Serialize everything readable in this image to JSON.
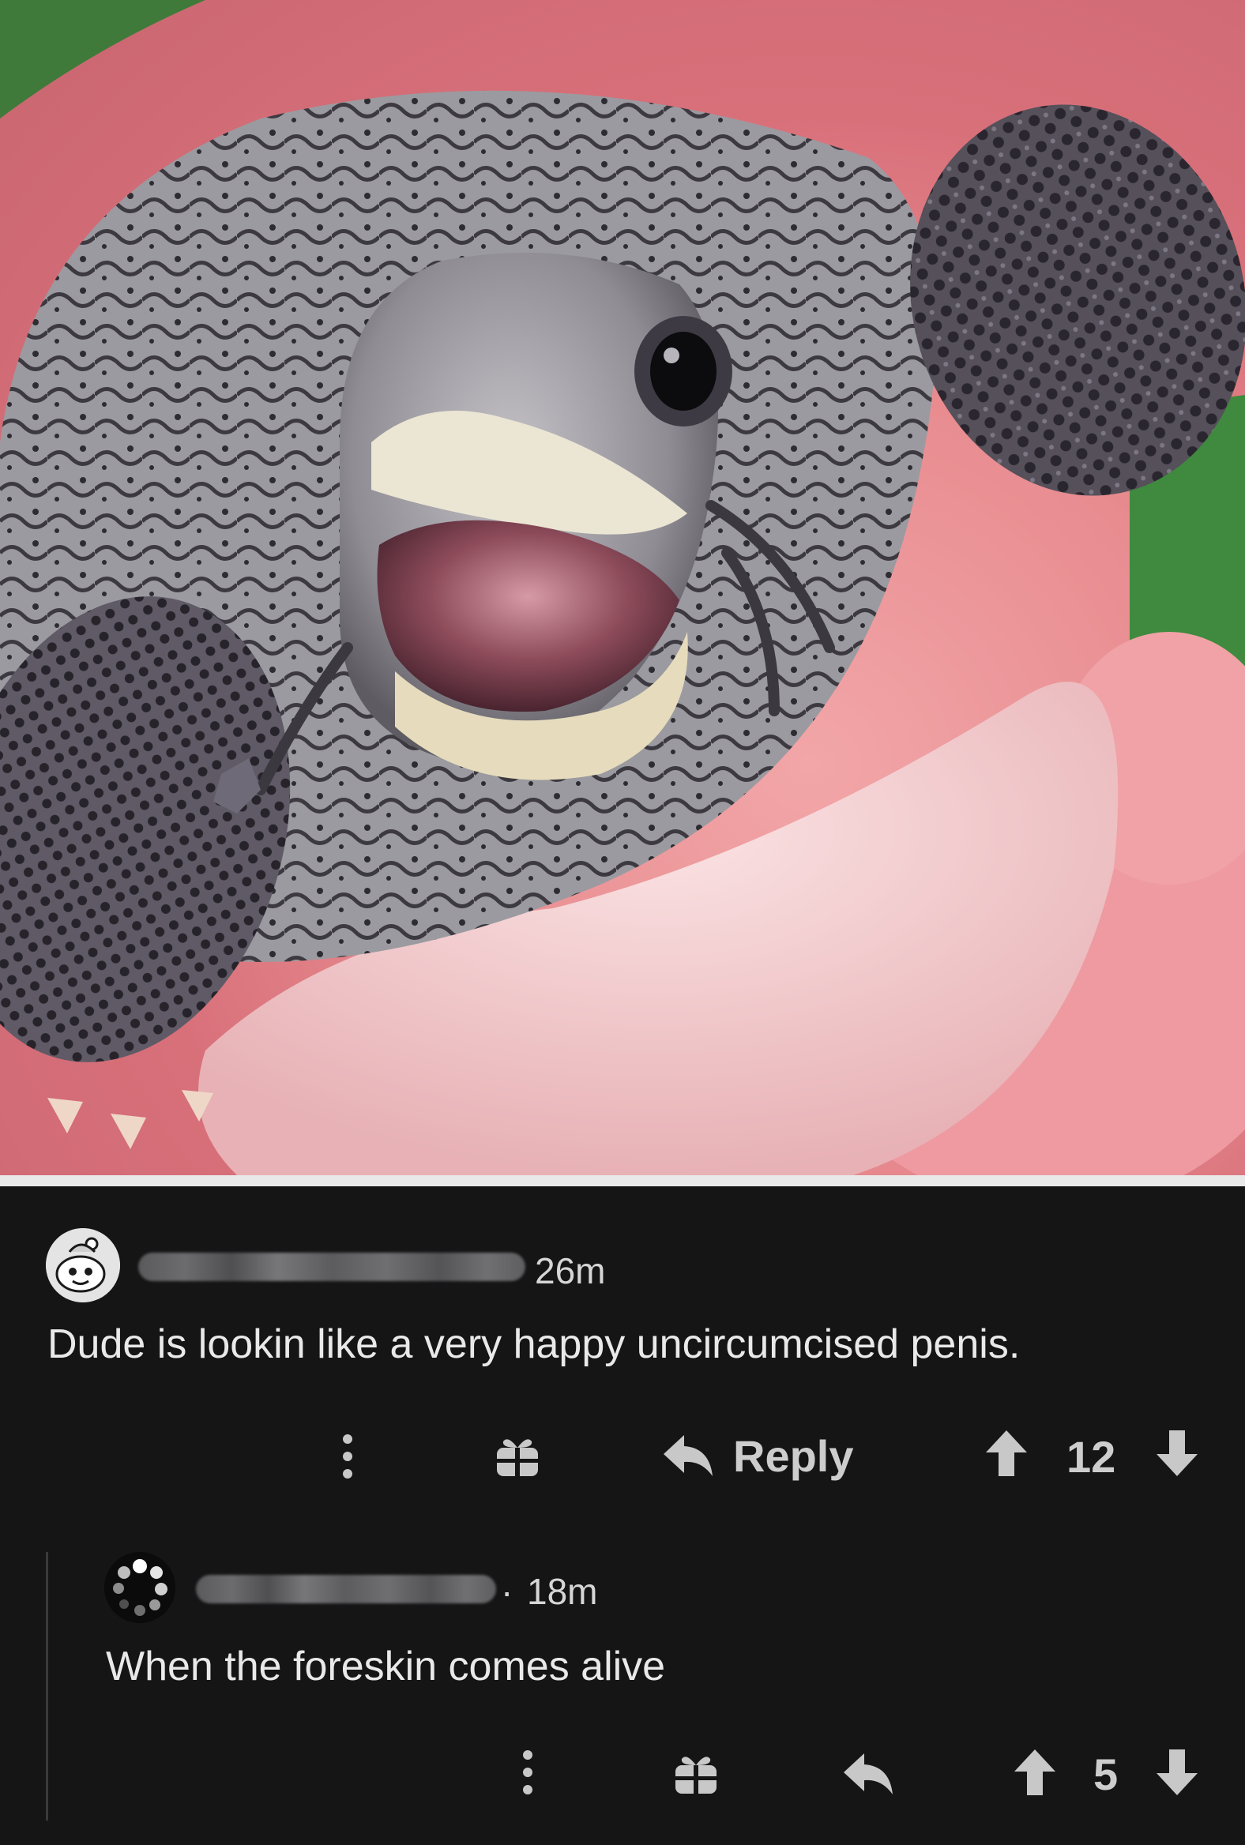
{
  "photo": {
    "subject_icon": "baby-turtle-hatching-photo"
  },
  "comments": [
    {
      "avatar_icon": "snoo-avatar-icon",
      "username_redacted": true,
      "timestamp": "26m",
      "body": "Dude is lookin like a very happy uncircumcised penis.",
      "actions": {
        "more_icon": "more-vertical-icon",
        "award_icon": "gift-icon",
        "reply_icon": "reply-arrow-icon",
        "reply_label": "Reply",
        "upvote_icon": "upvote-arrow-icon",
        "score": "12",
        "downvote_icon": "downvote-arrow-icon"
      }
    },
    {
      "avatar_icon": "dotted-avatar-icon",
      "username_redacted": true,
      "separator": "·",
      "timestamp": "18m",
      "body": "When the foreskin comes alive",
      "actions": {
        "more_icon": "more-vertical-icon",
        "award_icon": "gift-icon",
        "reply_icon": "reply-arrow-icon",
        "upvote_icon": "upvote-arrow-icon",
        "score": "5",
        "downvote_icon": "downvote-arrow-icon"
      }
    }
  ],
  "colors": {
    "background": "#141415",
    "text": "#e9e9e9",
    "muted": "#cdcdcd",
    "thread_line": "#3a3a3c"
  }
}
